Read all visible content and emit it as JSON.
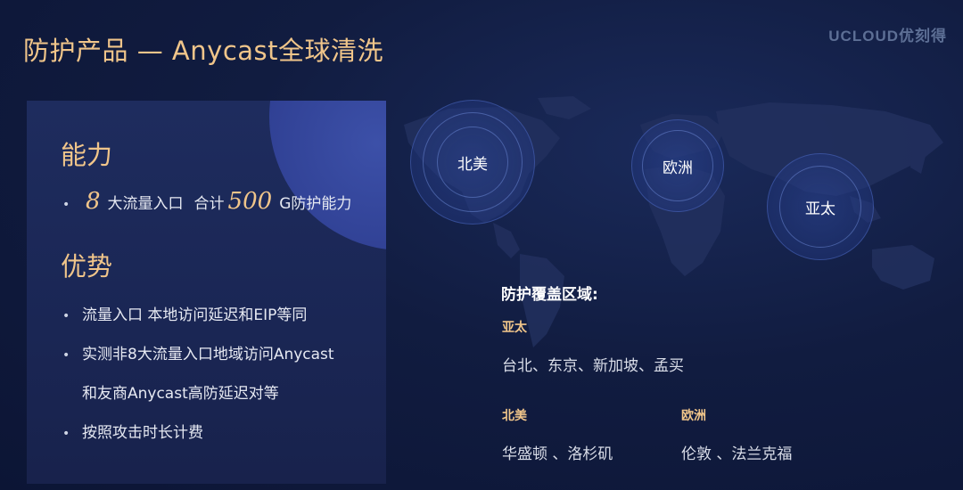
{
  "header": {
    "title": "防护产品 — Anycast全球清洗",
    "logo_text": "UCLOUD优刻得"
  },
  "panel": {
    "capability_heading": "能力",
    "capability": {
      "num1": "8",
      "text1": "大流量入口",
      "text2": "合计",
      "num2": "500",
      "text3": "G防护能力"
    },
    "advantage_heading": "优势",
    "advantages": [
      "流量入口 本地访问延迟和EIP等同",
      "实测非8大流量入口地域访问Anycast",
      "和友商Anycast高防延迟对等",
      "按照攻击时长计费"
    ]
  },
  "map": {
    "regions": [
      {
        "name": "北美"
      },
      {
        "name": "欧洲"
      },
      {
        "name": "亚太"
      }
    ]
  },
  "coverage": {
    "title": "防护覆盖区域:",
    "apac_label": "亚太",
    "apac_cities": "台北、东京、新加坡、孟买",
    "na_label": "北美",
    "na_cities": "华盛顿 、洛杉矶",
    "eu_label": "欧洲",
    "eu_cities": "伦敦 、法兰克福"
  },
  "colors": {
    "accent": "#f0c58a",
    "background": "#0f1a3a"
  }
}
